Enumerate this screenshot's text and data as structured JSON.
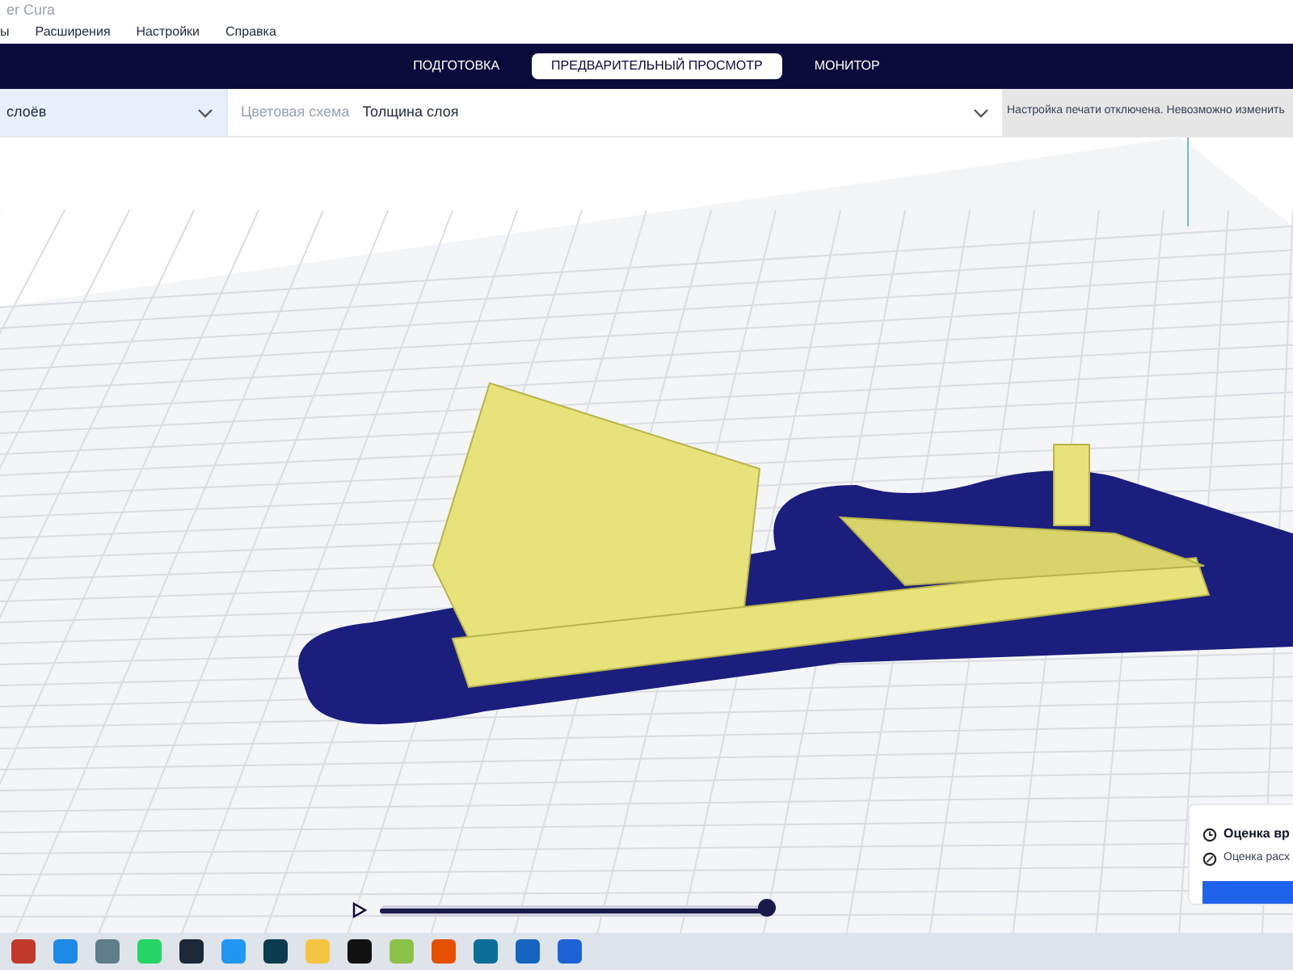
{
  "window": {
    "title": "er Cura"
  },
  "menu": [
    "ы",
    "Расширения",
    "Настройки",
    "Справка"
  ],
  "tabs": [
    {
      "label": "ПОДГОТОВКА",
      "selected": false
    },
    {
      "label": "ПРЕДВАРИТЕЛЬНЫЙ ПРОСМОТР",
      "selected": true
    },
    {
      "label": "МОНИТОР",
      "selected": false
    }
  ],
  "view_type": {
    "value": "слоёв"
  },
  "color_scheme": {
    "label": "Цветовая схема",
    "value": "Толщина слоя"
  },
  "notice": "Настройка печати отключена. Невозможно изменить",
  "layer_slider": {
    "level": 1
  },
  "estimate": {
    "time": "Оценка вр",
    "material": "Оценка расх"
  },
  "taskbar": [
    {
      "color": "#c0392b"
    },
    {
      "color": "#1e88e5"
    },
    {
      "color": "#607d8b"
    },
    {
      "color": "#25d366"
    },
    {
      "color": "#1b2838"
    },
    {
      "color": "#2196f3"
    },
    {
      "color": "#0d3b4f"
    },
    {
      "color": "#f4c542"
    },
    {
      "color": "#111111"
    },
    {
      "color": "#8bc34a"
    },
    {
      "color": "#e65100"
    },
    {
      "color": "#0b6e99"
    },
    {
      "color": "#1565c0"
    },
    {
      "color": "#1e63d6"
    }
  ]
}
